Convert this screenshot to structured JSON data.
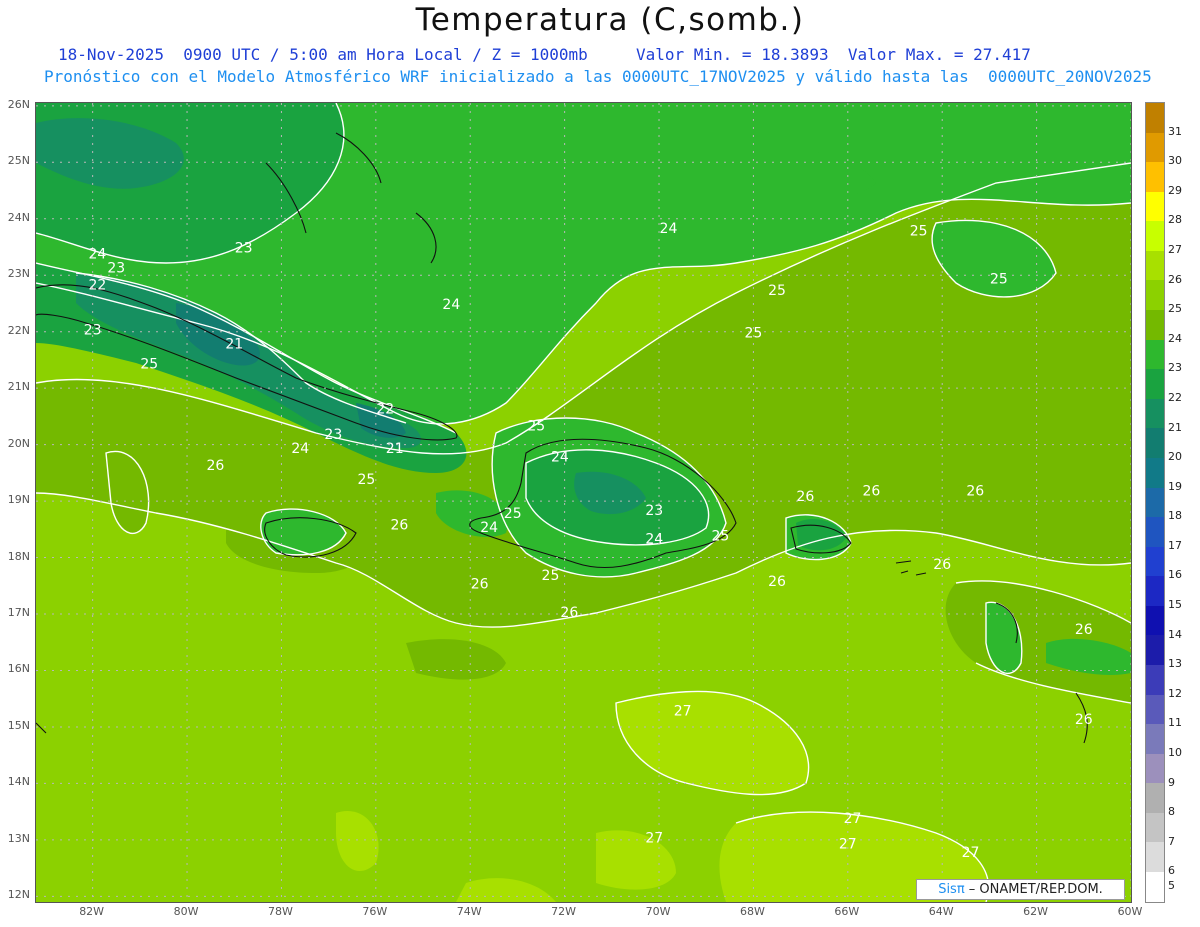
{
  "header": {
    "title": "Temperatura (C,somb.)",
    "subtitle_line1": "18-Nov-2025  0900 UTC / 5:00 am Hora Local / Z = 1000mb     Valor Min. = 18.3893  Valor Max. = 27.417",
    "subtitle_line2": "Pronóstico con el Modelo Atmosférico WRF inicializado a las 0000UTC_17NOV2025 y válido hasta las  0000UTC_20NOV2025"
  },
  "axes": {
    "lat_labels": [
      "26N",
      "25N",
      "24N",
      "23N",
      "22N",
      "21N",
      "20N",
      "19N",
      "18N",
      "17N",
      "16N",
      "15N",
      "14N",
      "13N",
      "12N"
    ],
    "lon_labels": [
      "82W",
      "80W",
      "78W",
      "76W",
      "74W",
      "72W",
      "70W",
      "68W",
      "66W",
      "64W",
      "62W",
      "60W"
    ]
  },
  "colorbar": {
    "labels": [
      "31",
      "30",
      "29",
      "28",
      "27",
      "26",
      "25",
      "24",
      "23",
      "22",
      "21",
      "20",
      "19",
      "18",
      "17",
      "16",
      "15",
      "14",
      "13",
      "12",
      "11",
      "10",
      "9",
      "8",
      "7",
      "6",
      "5"
    ],
    "colors": [
      "#c08000",
      "#e09a00",
      "#ffc000",
      "#ffff00",
      "#c8ff00",
      "#a8e000",
      "#8cd100",
      "#74b900",
      "#2eb82e",
      "#1aa340",
      "#169060",
      "#127d70",
      "#117a88",
      "#1c6aa8",
      "#1f55c0",
      "#2040d0",
      "#1c28c4",
      "#0f10b0",
      "#1c1caa",
      "#3c3cb8",
      "#5a5aba",
      "#7a7aba",
      "#9c90bc",
      "#b0b0b0",
      "#c4c4c4",
      "#dcdcdc",
      "#ffffff"
    ]
  },
  "map_labels": [
    {
      "text": "23",
      "lon": -78.8,
      "lat": 23.4
    },
    {
      "text": "24",
      "lon": -81.9,
      "lat": 23.3
    },
    {
      "text": "23",
      "lon": -81.5,
      "lat": 23.05
    },
    {
      "text": "22",
      "lon": -81.9,
      "lat": 22.75
    },
    {
      "text": "23",
      "lon": -82.0,
      "lat": 21.95
    },
    {
      "text": "21",
      "lon": -79.0,
      "lat": 21.7
    },
    {
      "text": "25",
      "lon": -80.8,
      "lat": 21.35
    },
    {
      "text": "22",
      "lon": -75.8,
      "lat": 20.55
    },
    {
      "text": "23",
      "lon": -76.9,
      "lat": 20.1
    },
    {
      "text": "24",
      "lon": -77.6,
      "lat": 19.85
    },
    {
      "text": "21",
      "lon": -75.6,
      "lat": 19.85
    },
    {
      "text": "25",
      "lon": -76.2,
      "lat": 19.3
    },
    {
      "text": "26",
      "lon": -79.4,
      "lat": 19.55
    },
    {
      "text": "26",
      "lon": -75.5,
      "lat": 18.5
    },
    {
      "text": "24",
      "lon": -74.4,
      "lat": 22.4
    },
    {
      "text": "24",
      "lon": -69.8,
      "lat": 23.75
    },
    {
      "text": "25",
      "lon": -67.5,
      "lat": 22.65
    },
    {
      "text": "25",
      "lon": -68.0,
      "lat": 21.9
    },
    {
      "text": "25",
      "lon": -72.6,
      "lat": 20.25
    },
    {
      "text": "24",
      "lon": -72.1,
      "lat": 19.7
    },
    {
      "text": "25",
      "lon": -73.1,
      "lat": 18.7
    },
    {
      "text": "24",
      "lon": -73.6,
      "lat": 18.45
    },
    {
      "text": "23",
      "lon": -70.1,
      "lat": 18.75
    },
    {
      "text": "24",
      "lon": -70.1,
      "lat": 18.25
    },
    {
      "text": "25",
      "lon": -68.7,
      "lat": 18.3
    },
    {
      "text": "25",
      "lon": -72.3,
      "lat": 17.6
    },
    {
      "text": "26",
      "lon": -73.8,
      "lat": 17.45
    },
    {
      "text": "26",
      "lon": -71.9,
      "lat": 16.95
    },
    {
      "text": "26",
      "lon": -66.9,
      "lat": 19.0
    },
    {
      "text": "26",
      "lon": -65.5,
      "lat": 19.1
    },
    {
      "text": "26",
      "lon": -63.3,
      "lat": 19.1
    },
    {
      "text": "26",
      "lon": -67.5,
      "lat": 17.5
    },
    {
      "text": "26",
      "lon": -64.0,
      "lat": 17.8
    },
    {
      "text": "25",
      "lon": -64.5,
      "lat": 23.7
    },
    {
      "text": "25",
      "lon": -62.8,
      "lat": 22.85
    },
    {
      "text": "26",
      "lon": -61.0,
      "lat": 16.65
    },
    {
      "text": "26",
      "lon": -61.0,
      "lat": 15.05
    },
    {
      "text": "27",
      "lon": -69.5,
      "lat": 15.2
    },
    {
      "text": "27",
      "lon": -70.1,
      "lat": 12.95
    },
    {
      "text": "27",
      "lon": -65.9,
      "lat": 13.3
    },
    {
      "text": "27",
      "lon": -66.0,
      "lat": 12.85
    },
    {
      "text": "27",
      "lon": -63.4,
      "lat": 12.7
    }
  ],
  "credit": {
    "sis": "Sisπ",
    "rest": " – ONAMET/REP.DOM."
  }
}
